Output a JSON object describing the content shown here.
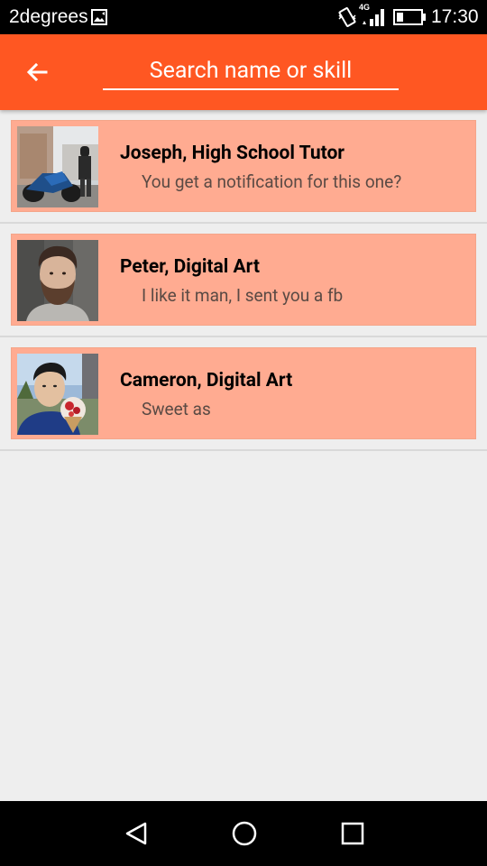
{
  "status_bar": {
    "carrier": "2degrees",
    "network": "4G",
    "time": "17:30"
  },
  "app_bar": {
    "search_placeholder": "Search name or skill"
  },
  "contacts": [
    {
      "name": "Joseph, High School Tutor",
      "message": "You get a notification for this one?"
    },
    {
      "name": "Peter, Digital Art",
      "message": "I like it man, I sent you a fb"
    },
    {
      "name": "Cameron, Digital Art",
      "message": "Sweet as"
    }
  ],
  "colors": {
    "app_bar": "#ff5722",
    "card": "#ffab91",
    "background": "#eeeeee"
  }
}
